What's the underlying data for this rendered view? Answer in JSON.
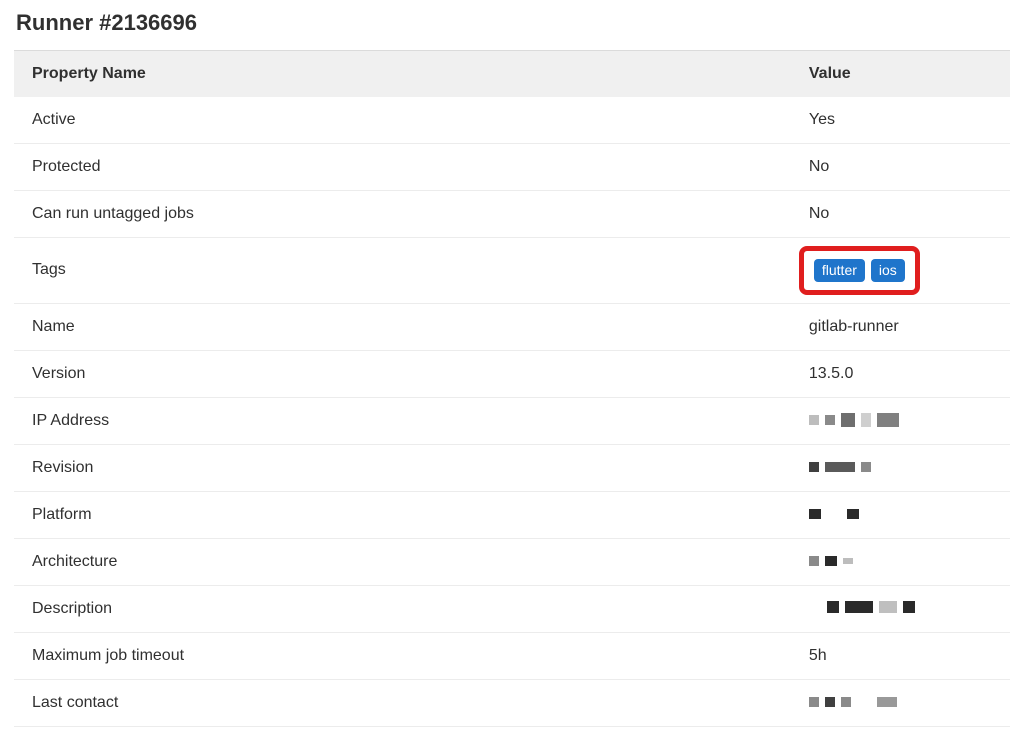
{
  "title": "Runner #2136696",
  "table": {
    "headers": {
      "prop": "Property Name",
      "val": "Value"
    },
    "rows": {
      "active": {
        "prop": "Active",
        "val": "Yes"
      },
      "protected": {
        "prop": "Protected",
        "val": "No"
      },
      "untagged": {
        "prop": "Can run untagged jobs",
        "val": "No"
      },
      "tags": {
        "prop": "Tags",
        "tags": [
          "flutter",
          "ios"
        ]
      },
      "name": {
        "prop": "Name",
        "val": "gitlab-runner"
      },
      "version": {
        "prop": "Version",
        "val": "13.5.0"
      },
      "ip": {
        "prop": "IP Address",
        "val": ""
      },
      "revision": {
        "prop": "Revision",
        "val": ""
      },
      "platform": {
        "prop": "Platform",
        "val": ""
      },
      "arch": {
        "prop": "Architecture",
        "val": ""
      },
      "desc": {
        "prop": "Description",
        "val": ""
      },
      "timeout": {
        "prop": "Maximum job timeout",
        "val": "5h"
      },
      "contact": {
        "prop": "Last contact",
        "val": ""
      }
    }
  }
}
